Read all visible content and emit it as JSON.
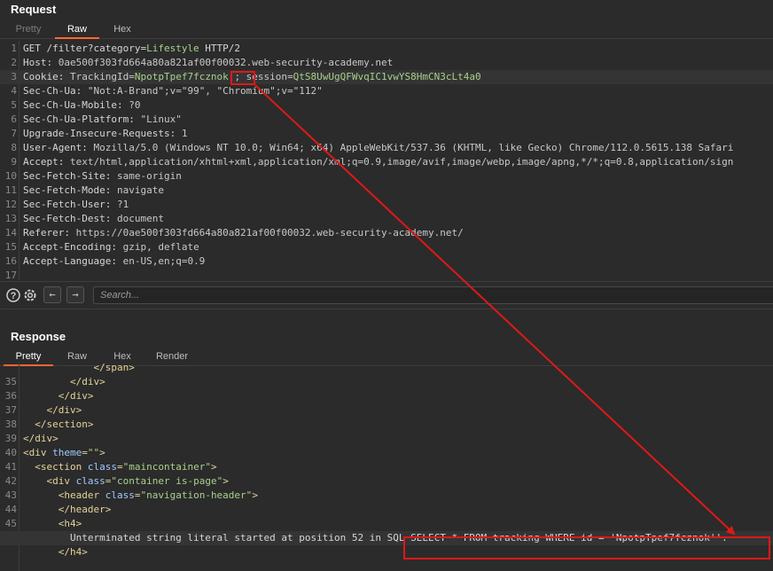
{
  "request": {
    "title": "Request",
    "tabs": [
      "Pretty",
      "Raw",
      "Hex"
    ],
    "lines": [
      {
        "n": "1",
        "parts": [
          [
            "GET /filter?category=",
            "k"
          ],
          [
            "Lifestyle",
            "g"
          ],
          [
            " HTTP/2",
            "k"
          ]
        ]
      },
      {
        "n": "2",
        "parts": [
          [
            "Host: ",
            "k"
          ],
          [
            "0ae500f303fd664a80a821af00f00032.web-security-academy.net",
            "v"
          ]
        ]
      },
      {
        "n": "3",
        "parts": [
          [
            "Cookie: ",
            "k"
          ],
          [
            "TrackingId=",
            "v"
          ],
          [
            "NpotpTpef7fcznok'",
            "g"
          ],
          [
            "; session=",
            "v"
          ],
          [
            "QtS8UwUgQFWvqIC1vwYS8HmCN3cLt4a0",
            "g"
          ]
        ]
      },
      {
        "n": "4",
        "parts": [
          [
            "Sec-Ch-Ua: ",
            "k"
          ],
          [
            "\"Not:A-Brand\";v=\"99\", \"Chromium\";v=\"112\"",
            "v"
          ]
        ]
      },
      {
        "n": "5",
        "parts": [
          [
            "Sec-Ch-Ua-Mobile: ",
            "k"
          ],
          [
            "?0",
            "v"
          ]
        ]
      },
      {
        "n": "6",
        "parts": [
          [
            "Sec-Ch-Ua-Platform: ",
            "k"
          ],
          [
            "\"Linux\"",
            "v"
          ]
        ]
      },
      {
        "n": "7",
        "parts": [
          [
            "Upgrade-Insecure-Requests: ",
            "k"
          ],
          [
            "1",
            "v"
          ]
        ]
      },
      {
        "n": "8",
        "parts": [
          [
            "User-Agent: ",
            "k"
          ],
          [
            "Mozilla/5.0 (Windows NT 10.0; Win64; x64) AppleWebKit/537.36 (KHTML, like Gecko) Chrome/112.0.5615.138 Safari",
            "v"
          ]
        ]
      },
      {
        "n": "9",
        "parts": [
          [
            "Accept: ",
            "k"
          ],
          [
            "text/html,application/xhtml+xml,application/xml;q=0.9,image/avif,image/webp,image/apng,*/*;q=0.8,application/sign",
            "v"
          ]
        ]
      },
      {
        "n": "10",
        "parts": [
          [
            "Sec-Fetch-Site: ",
            "k"
          ],
          [
            "same-origin",
            "v"
          ]
        ]
      },
      {
        "n": "11",
        "parts": [
          [
            "Sec-Fetch-Mode: ",
            "k"
          ],
          [
            "navigate",
            "v"
          ]
        ]
      },
      {
        "n": "12",
        "parts": [
          [
            "Sec-Fetch-User: ",
            "k"
          ],
          [
            "?1",
            "v"
          ]
        ]
      },
      {
        "n": "13",
        "parts": [
          [
            "Sec-Fetch-Dest: ",
            "k"
          ],
          [
            "document",
            "v"
          ]
        ]
      },
      {
        "n": "14",
        "parts": [
          [
            "Referer: ",
            "k"
          ],
          [
            "https://0ae500f303fd664a80a821af00f00032.web-security-academy.net/",
            "v"
          ]
        ]
      },
      {
        "n": "15",
        "parts": [
          [
            "Accept-Encoding: ",
            "k"
          ],
          [
            "gzip, deflate",
            "v"
          ]
        ]
      },
      {
        "n": "16",
        "parts": [
          [
            "Accept-Language: ",
            "k"
          ],
          [
            "en-US,en;q=0.9",
            "v"
          ]
        ]
      },
      {
        "n": "17",
        "parts": []
      }
    ]
  },
  "search": {
    "placeholder": "Search...",
    "help_icon": "help-icon",
    "settings_icon": "gear-icon",
    "prev_icon": "arrow-left-icon",
    "next_icon": "arrow-right-icon",
    "help_glyph": "?",
    "prev_glyph": "←",
    "next_glyph": "→"
  },
  "response": {
    "title": "Response",
    "tabs": [
      "Pretty",
      "Raw",
      "Hex",
      "Render"
    ],
    "lines": [
      {
        "n": "",
        "parts": [
          [
            "            </span>",
            "t"
          ]
        ]
      },
      {
        "n": "35",
        "parts": [
          [
            "        </div>",
            "t"
          ]
        ]
      },
      {
        "n": "36",
        "parts": [
          [
            "      </div>",
            "t"
          ]
        ]
      },
      {
        "n": "37",
        "parts": [
          [
            "    </div>",
            "t"
          ]
        ]
      },
      {
        "n": "38",
        "parts": [
          [
            "  </section>",
            "t"
          ]
        ]
      },
      {
        "n": "39",
        "parts": [
          [
            "</div>",
            "t"
          ]
        ]
      },
      {
        "n": "40",
        "parts": [
          [
            "<div ",
            "t"
          ],
          [
            "theme",
            "a"
          ],
          [
            "=",
            "t"
          ],
          [
            "\"\"",
            "s"
          ],
          [
            ">",
            "t"
          ]
        ]
      },
      {
        "n": "41",
        "parts": [
          [
            "  <section ",
            "t"
          ],
          [
            "class",
            "a"
          ],
          [
            "=",
            "t"
          ],
          [
            "\"maincontainer\"",
            "s"
          ],
          [
            ">",
            "t"
          ]
        ]
      },
      {
        "n": "42",
        "parts": [
          [
            "    <div ",
            "t"
          ],
          [
            "class",
            "a"
          ],
          [
            "=",
            "t"
          ],
          [
            "\"container is-page\"",
            "s"
          ],
          [
            ">",
            "t"
          ]
        ]
      },
      {
        "n": "43",
        "parts": [
          [
            "      <header ",
            "t"
          ],
          [
            "class",
            "a"
          ],
          [
            "=",
            "t"
          ],
          [
            "\"navigation-header\"",
            "s"
          ],
          [
            ">",
            "t"
          ]
        ]
      },
      {
        "n": "44",
        "parts": [
          [
            "      </header>",
            "t"
          ]
        ]
      },
      {
        "n": "45",
        "parts": [
          [
            "      <h4>",
            "t"
          ]
        ]
      },
      {
        "n": "",
        "parts": [
          [
            "        Unterminated string literal started at position 52 in SQL SELECT * FROM tracking WHERE id = 'NpotpTpef7fcznok''.",
            "k"
          ]
        ]
      },
      {
        "n": "",
        "parts": [
          [
            "      </h4>",
            "t"
          ]
        ]
      }
    ]
  },
  "colors": {
    "accent": "#ff6633",
    "highlight_box": "#e01818",
    "background": "#2b2b2b"
  }
}
